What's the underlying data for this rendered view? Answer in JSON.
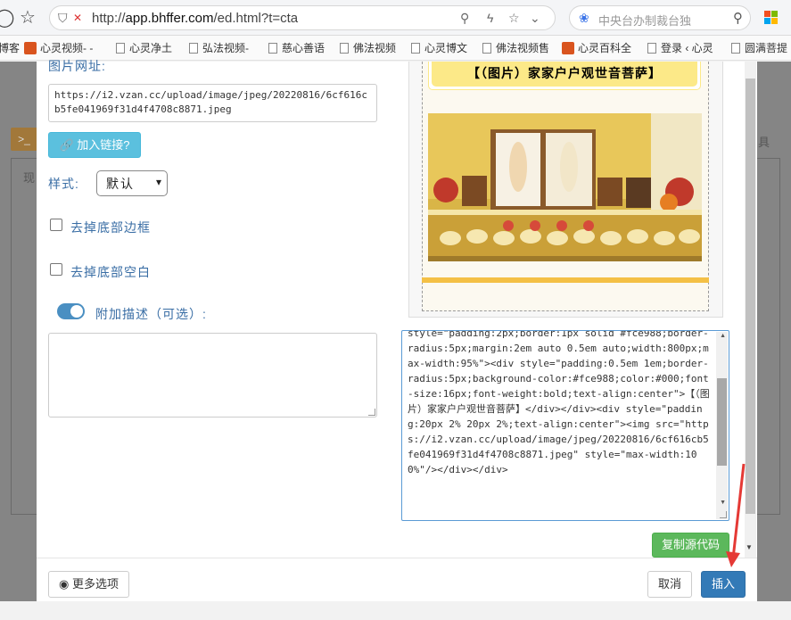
{
  "browser": {
    "url_prefix": "http://",
    "url_host": "app.bhffer.com",
    "url_path": "/ed.html?t=cta",
    "search_placeholder": "中央台办制裁台独",
    "bookmarks": [
      "博客",
      "心灵视频- -",
      "心灵净土",
      "弘法视频-",
      "慈心善语",
      "佛法视频",
      "心灵博文",
      "佛法视频售",
      "心灵百科全",
      "登录 ‹ 心灵",
      "圆满菩提"
    ]
  },
  "background_page": {
    "left_button": ">_",
    "left_text": "现",
    "right_text": "具"
  },
  "form": {
    "image_url_label": "图片网址:",
    "image_url_value": "https://i2.vzan.cc/upload/image/jpeg/20220816/6cf616cb5fe041969f31d4f4708c8871.jpeg",
    "add_link_label": "加入链接?",
    "style_label": "样式:",
    "style_selected": "默认",
    "remove_bottom_border_label": "去掉底部边框",
    "remove_bottom_space_label": "去掉底部空白",
    "description_toggle_label": "附加描述（可选）:"
  },
  "preview": {
    "title": "【（图片）家家户户观世音菩萨】"
  },
  "source_code": "style=\"padding:2px;border:1px solid #fce988;border-radius:5px;margin:2em auto 0.5em auto;width:800px;max-width:95%\"><div style=\"padding:0.5em 1em;border-radius:5px;background-color:#fce988;color:#000;font-size:16px;font-weight:bold;text-align:center\">【（图片）家家户户观世音菩萨】</div></div><div style=\"padding:20px 2% 20px 2%;text-align:center\"><img src=\"https://i2.vzan.cc/upload/image/jpeg/20220816/6cf616cb5fe041969f31d4f4708c8871.jpeg\" style=\"max-width:100%\"/></div></div>",
  "buttons": {
    "copy_source": "复制源代码",
    "more_options": "更多选项",
    "cancel": "取消",
    "insert": "插入"
  },
  "icons": {
    "back": "circle-back-icon",
    "favorite": "star-icon",
    "link": "link-icon",
    "eye": "eye-icon"
  },
  "colors": {
    "preview_title_bg": "#fce988",
    "insert_button": "#337ab7",
    "copy_button": "#5cb85c",
    "add_link_button": "#5bc0de",
    "annotation_arrow": "#e53935"
  }
}
